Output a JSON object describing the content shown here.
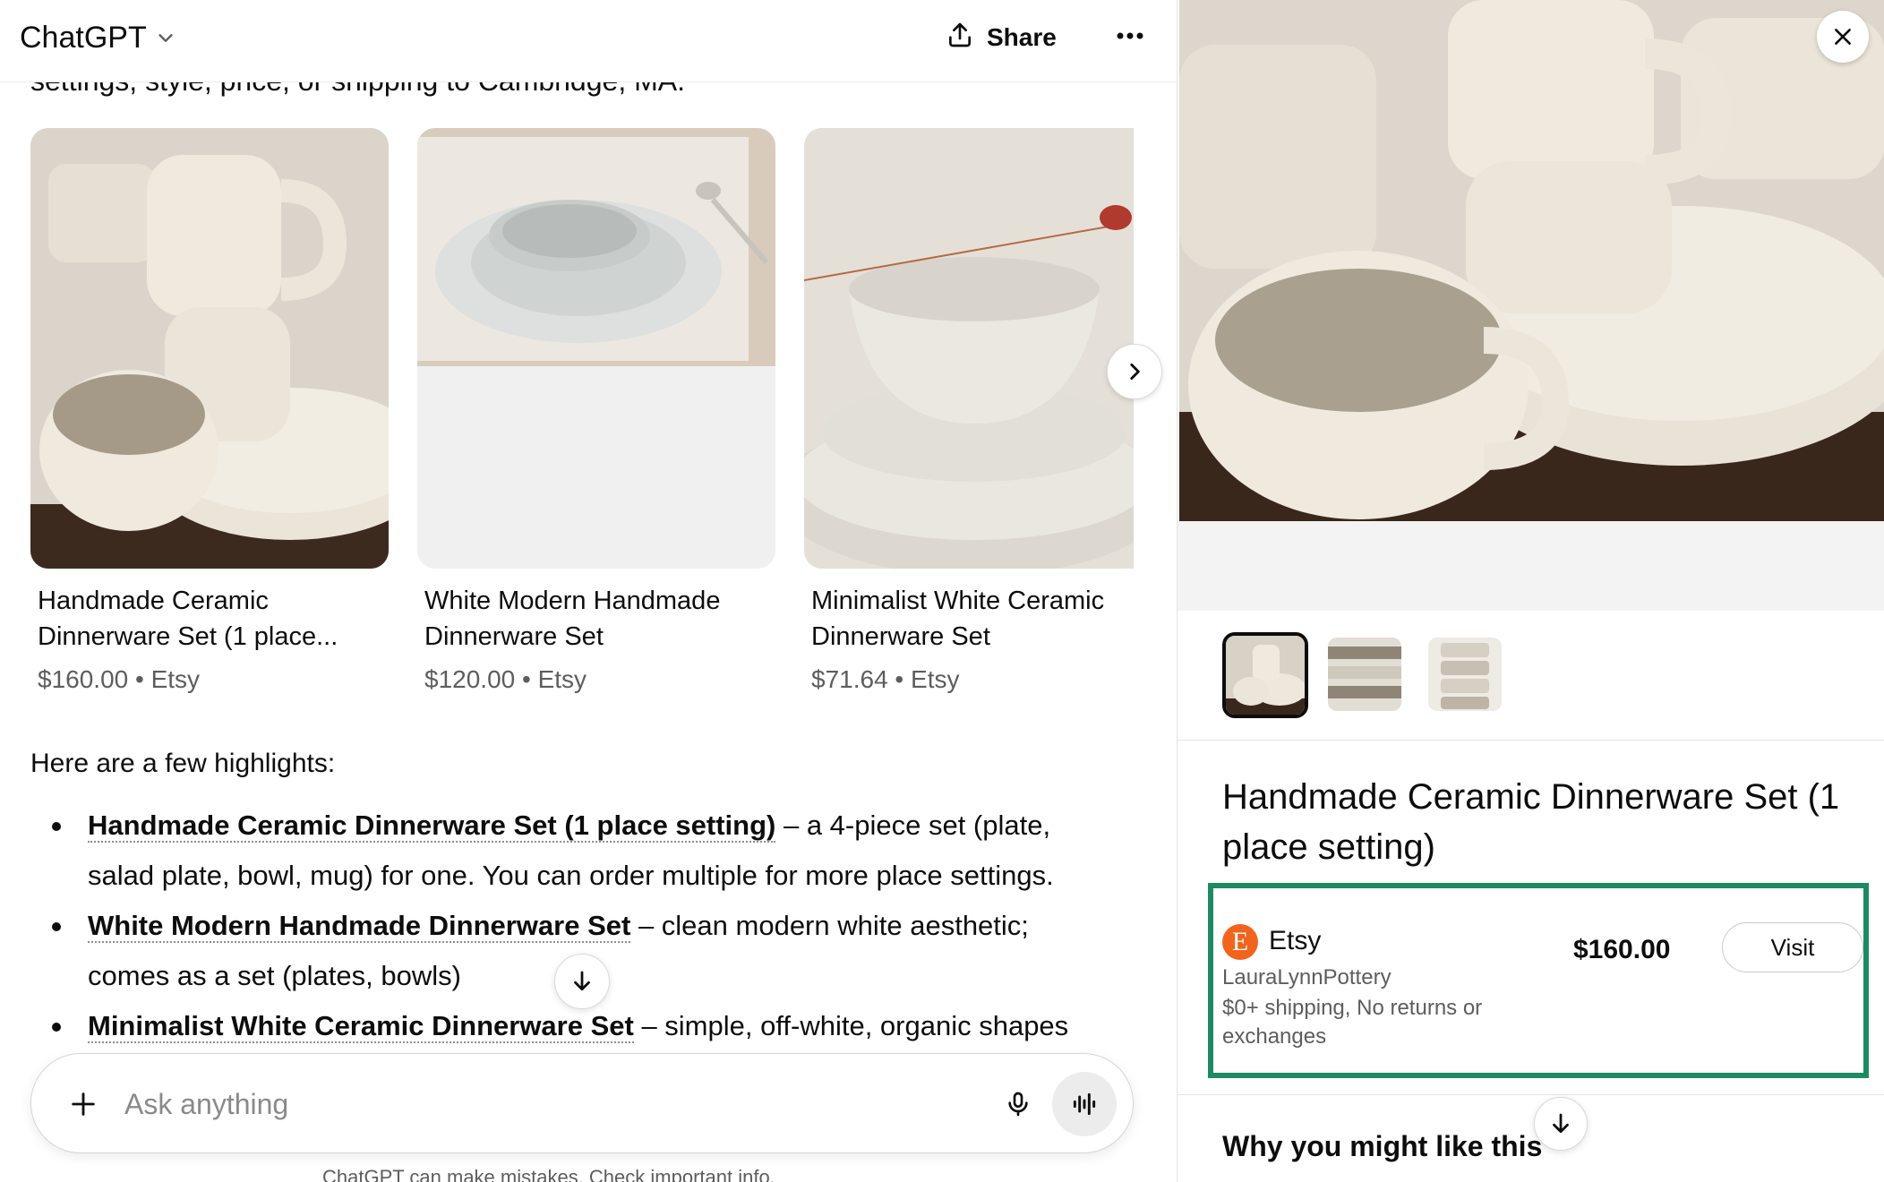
{
  "header": {
    "model_name": "ChatGPT",
    "share_label": "Share"
  },
  "chat": {
    "cut_text": "settings, style, price, or shipping to Cambridge, MA.",
    "products": [
      {
        "title": "Handmade Ceramic Dinnerware Set (1 place...",
        "price": "$160.00",
        "separator": "•",
        "store": "Etsy"
      },
      {
        "title": "White Modern Handmade Dinnerware Set",
        "price": "$120.00",
        "separator": "•",
        "store": "Etsy"
      },
      {
        "title": "Minimalist White Ceramic Dinnerware Set",
        "price": "$71.64",
        "separator": "•",
        "store": "Etsy"
      }
    ],
    "highlights_intro": "Here are a few highlights:",
    "highlights": [
      {
        "link": "Handmade Ceramic Dinnerware Set (1 place setting)",
        "text": " – a 4-piece set (plate, salad plate, bowl, mug) for one. You can order multiple for more place settings."
      },
      {
        "link": "White Modern Handmade Dinnerware Set",
        "text": " – clean modern white aesthetic; comes as a set (plates, bowls)"
      },
      {
        "link": "Minimalist White Ceramic Dinnerware Set",
        "text": " – simple, off-white, organic shapes"
      }
    ]
  },
  "composer": {
    "placeholder": "Ask anything",
    "footnote": "ChatGPT can make mistakes. Check important info."
  },
  "product_panel": {
    "title": "Handmade Ceramic Dinnerware Set (1 place setting)",
    "offer": {
      "store": "Etsy",
      "store_logo_letter": "E",
      "seller": "LauraLynnPottery",
      "shipping": "$0+ shipping, No returns or exchanges",
      "price": "$160.00",
      "visit_label": "Visit"
    },
    "why_heading": "Why you might like this"
  },
  "colors": {
    "etsy_orange": "#f1641e",
    "highlight_border": "#1e8a62"
  }
}
